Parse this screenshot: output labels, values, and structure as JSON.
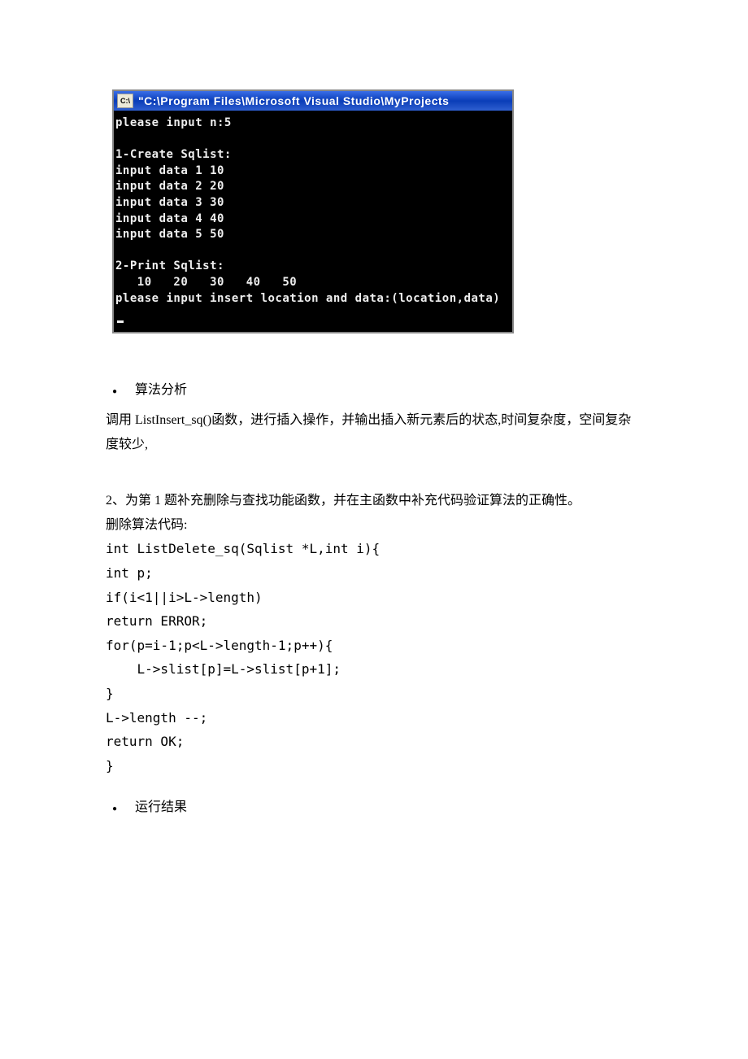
{
  "console": {
    "icon_label": "C:\\",
    "title": "\"C:\\Program Files\\Microsoft Visual Studio\\MyProjects",
    "lines": "please input n:5\n\n1-Create Sqlist:\ninput data 1 10\ninput data 2 20\ninput data 3 30\ninput data 4 40\ninput data 5 50\n\n2-Print Sqlist:\n   10   20   30   40   50\nplease input insert location and data:(location,data)"
  },
  "section1": {
    "heading": "算法分析",
    "paragraph": "调用 ListInsert_sq()函数，进行插入操作，并输出插入新元素后的状态,时间复杂度，空间复杂度较少,"
  },
  "section2": {
    "intro": "2、为第 1 题补充删除与查找功能函数，并在主函数中补充代码验证算法的正确性。",
    "label": "删除算法代码:",
    "code": "int ListDelete_sq(Sqlist *L,int i){\nint p;\nif(i<1||i>L->length)\nreturn ERROR;\nfor(p=i-1;p<L->length-1;p++){\n    L->slist[p]=L->slist[p+1];\n}\nL->length --;\nreturn OK;\n}"
  },
  "section3": {
    "heading": "运行结果"
  }
}
